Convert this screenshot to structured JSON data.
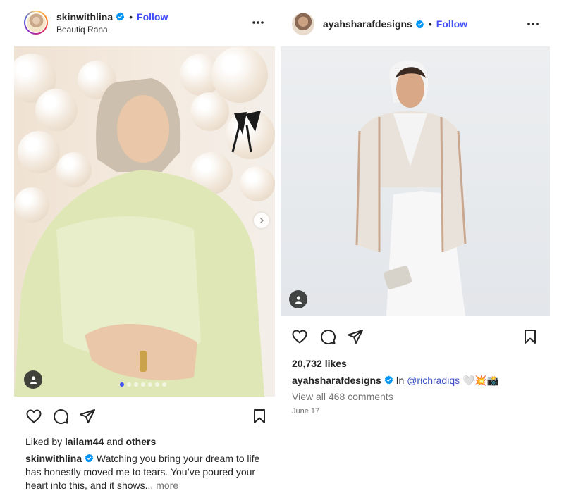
{
  "post_left": {
    "username": "skinwithlina",
    "subtitle": "Beautiq Rana",
    "follow_label": "Follow",
    "liked_by_prefix": "Liked by",
    "liked_by_user": "lailam44",
    "liked_by_and": "and",
    "liked_by_others": "others",
    "caption_user": "skinwithlina",
    "caption_text": "Watching you bring your dream to life has honestly moved me to tears. You’ve poured your heart into this, and it shows...",
    "caption_more": "more",
    "carousel": {
      "count": 7,
      "active_index": 0
    }
  },
  "post_right": {
    "username": "ayahsharafdesigns",
    "follow_label": "Follow",
    "likes": "20,732 likes",
    "caption_user": "ayahsharafdesigns",
    "caption_in": "In",
    "caption_mention": "@richradiqs",
    "caption_emoji": "🤍💥📸",
    "view_comments": "View all 468 comments",
    "date": "June 17"
  },
  "icons": {
    "verified": "verified-badge-icon",
    "more": "more-options-icon",
    "like": "heart-icon",
    "comment": "comment-icon",
    "share": "share-icon",
    "save": "bookmark-icon",
    "tag": "user-tag-icon",
    "next": "chevron-right-icon"
  },
  "colors": {
    "link": "#4150f7",
    "verified": "#0095f6",
    "text": "#262626",
    "muted": "#737373"
  }
}
